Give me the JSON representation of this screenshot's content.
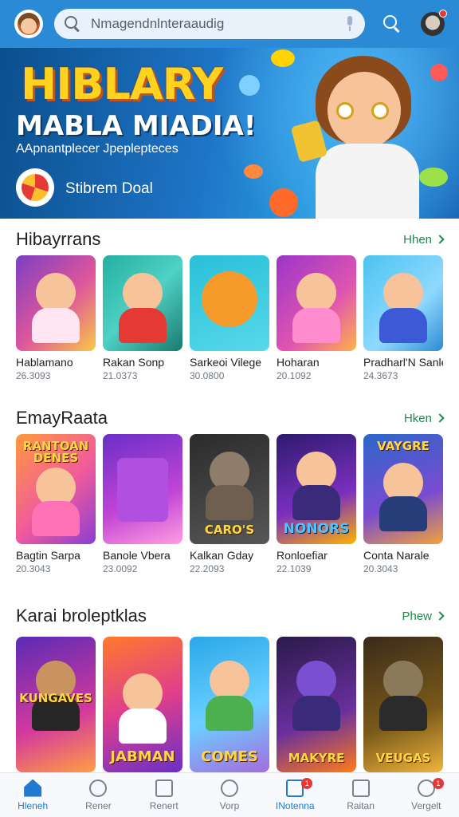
{
  "search": {
    "placeholder": "Nmagendnlnteraaudig"
  },
  "hero": {
    "title": "HIBLARY",
    "subtitle": "MABLA MIADIA!",
    "tagline": "AApnantplecer  Jpeplepteces",
    "brand": "Stibrem Doal"
  },
  "sections": [
    {
      "title": "Hibayrrans",
      "more": "Hhen",
      "items": [
        {
          "name": "Hablamano",
          "meta": "26.3093",
          "caption": ""
        },
        {
          "name": "Rakan Sonp",
          "meta": "21.0373",
          "caption": ""
        },
        {
          "name": "Sarkeoi Vilege",
          "meta": "30.0800",
          "caption": ""
        },
        {
          "name": "Hoharan",
          "meta": "20.1092",
          "caption": ""
        },
        {
          "name": "Pradharl'N Sanle",
          "meta": "24.3673",
          "caption": ""
        }
      ]
    },
    {
      "title": "EmayRaata",
      "more": "Hken",
      "items": [
        {
          "name": "Bagtin Sarpa",
          "meta": "20.3043",
          "caption": "RANTOAN DENES"
        },
        {
          "name": "Banole Vbera",
          "meta": "23.0092",
          "caption": ""
        },
        {
          "name": "Kalkan Gday",
          "meta": "22.2093",
          "caption": "CARO'S"
        },
        {
          "name": "Ronloefiar",
          "meta": "22.1039",
          "caption": "NONORS"
        },
        {
          "name": "Conta Narale",
          "meta": "20.3043",
          "caption": "VAYGRE"
        }
      ]
    },
    {
      "title": "Karai broleptklas",
      "more": "Phew",
      "items": [
        {
          "name": "",
          "meta": "",
          "caption": "KUNGAVES"
        },
        {
          "name": "",
          "meta": "",
          "caption": "JABMAN"
        },
        {
          "name": "",
          "meta": "",
          "caption": "COMES"
        },
        {
          "name": "",
          "meta": "",
          "caption": "MAKYRE"
        },
        {
          "name": "",
          "meta": "",
          "caption": "VEUGAS"
        }
      ]
    }
  ],
  "nav": [
    {
      "label": "Hleneh",
      "icon": "home-icon",
      "badge": ""
    },
    {
      "label": "Rener",
      "icon": "compass-icon",
      "badge": ""
    },
    {
      "label": "Renert",
      "icon": "store-icon",
      "badge": ""
    },
    {
      "label": "Vorp",
      "icon": "games-icon",
      "badge": ""
    },
    {
      "label": "INotenna",
      "icon": "notification-icon",
      "badge": "1"
    },
    {
      "label": "Raitan",
      "icon": "list-icon",
      "badge": ""
    },
    {
      "label": "Vergelt",
      "icon": "profile-icon",
      "badge": "1"
    }
  ]
}
